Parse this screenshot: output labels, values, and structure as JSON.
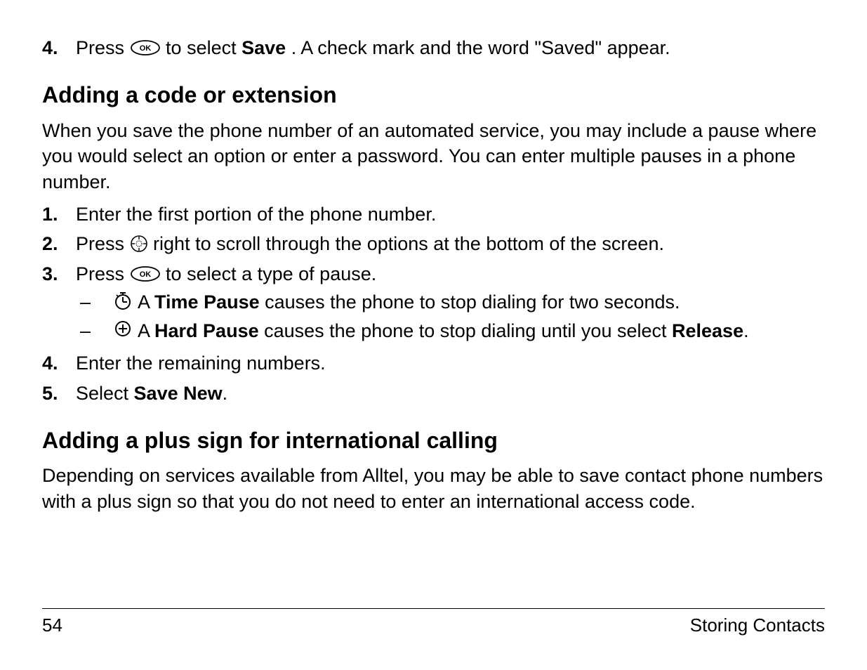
{
  "top_item": {
    "num": "4.",
    "press": "Press ",
    "to_select": " to select ",
    "save": "Save",
    "rest": ". A check mark and the word \"Saved\" appear."
  },
  "section1": {
    "heading": "Adding a code or extension",
    "intro": "When you save the phone number of an automated service, you may include a pause where you would select an option or enter a password. You can enter multiple pauses in a phone number.",
    "step1": {
      "num": "1.",
      "text": "Enter the first portion of the phone number."
    },
    "step2": {
      "num": "2.",
      "press": "Press ",
      "rest": " right to scroll through the options at the bottom of the screen."
    },
    "step3": {
      "num": "3.",
      "press": "Press ",
      "rest": " to select a type of pause.",
      "sub1": {
        "dash": "–",
        "a": " A ",
        "label": "Time Pause",
        "rest": " causes the phone to stop dialing for two seconds."
      },
      "sub2": {
        "dash": "–",
        "a": " A ",
        "label": "Hard Pause",
        "rest1": " causes the phone to stop dialing until you select ",
        "release": "Release",
        "rest2": "."
      }
    },
    "step4": {
      "num": "4.",
      "text": "Enter the remaining numbers."
    },
    "step5": {
      "num": "5.",
      "select": "Select ",
      "savenew": "Save New",
      "dot": "."
    }
  },
  "section2": {
    "heading": "Adding a plus sign for international calling",
    "intro": "Depending on services available from Alltel, you may be able to save contact phone numbers with a plus sign so that you do not need to enter an international access code."
  },
  "footer": {
    "page": "54",
    "section": "Storing Contacts"
  }
}
